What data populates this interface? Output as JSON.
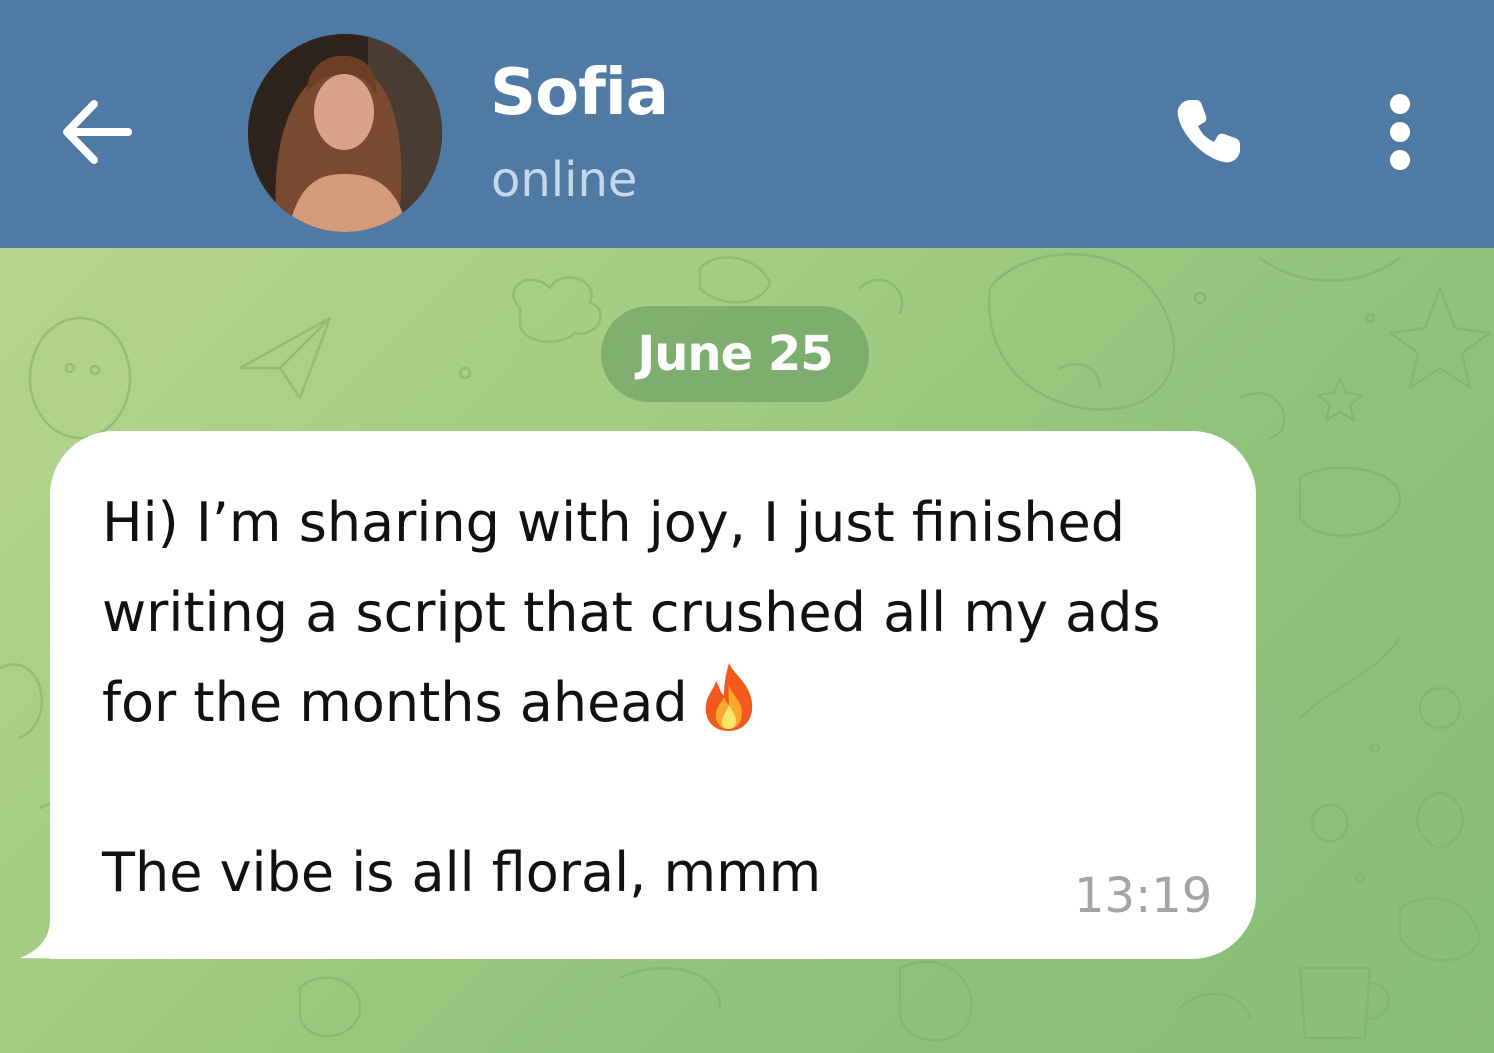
{
  "header": {
    "contact_name": "Sofia",
    "status": "online",
    "background_color": "#4f7aa3",
    "icons": {
      "back": "arrow-left-icon",
      "call": "phone-icon",
      "menu": "more-vertical-icon"
    }
  },
  "chat": {
    "date_separator": "June 25",
    "messages": [
      {
        "direction": "incoming",
        "lines": [
          "Hi) I’m sharing with joy, I just finished",
          "writing a script that crushed all my ads",
          "for the months ahead"
        ],
        "emoji": "fire-emoji",
        "last_line": "The vibe is all floral, mmm",
        "time": "13:19"
      }
    ]
  },
  "colors": {
    "header": "#4f7aa3",
    "chat_bg": "#a3cd83",
    "bubble": "#ffffff",
    "date_pill": "#6b9d64"
  }
}
